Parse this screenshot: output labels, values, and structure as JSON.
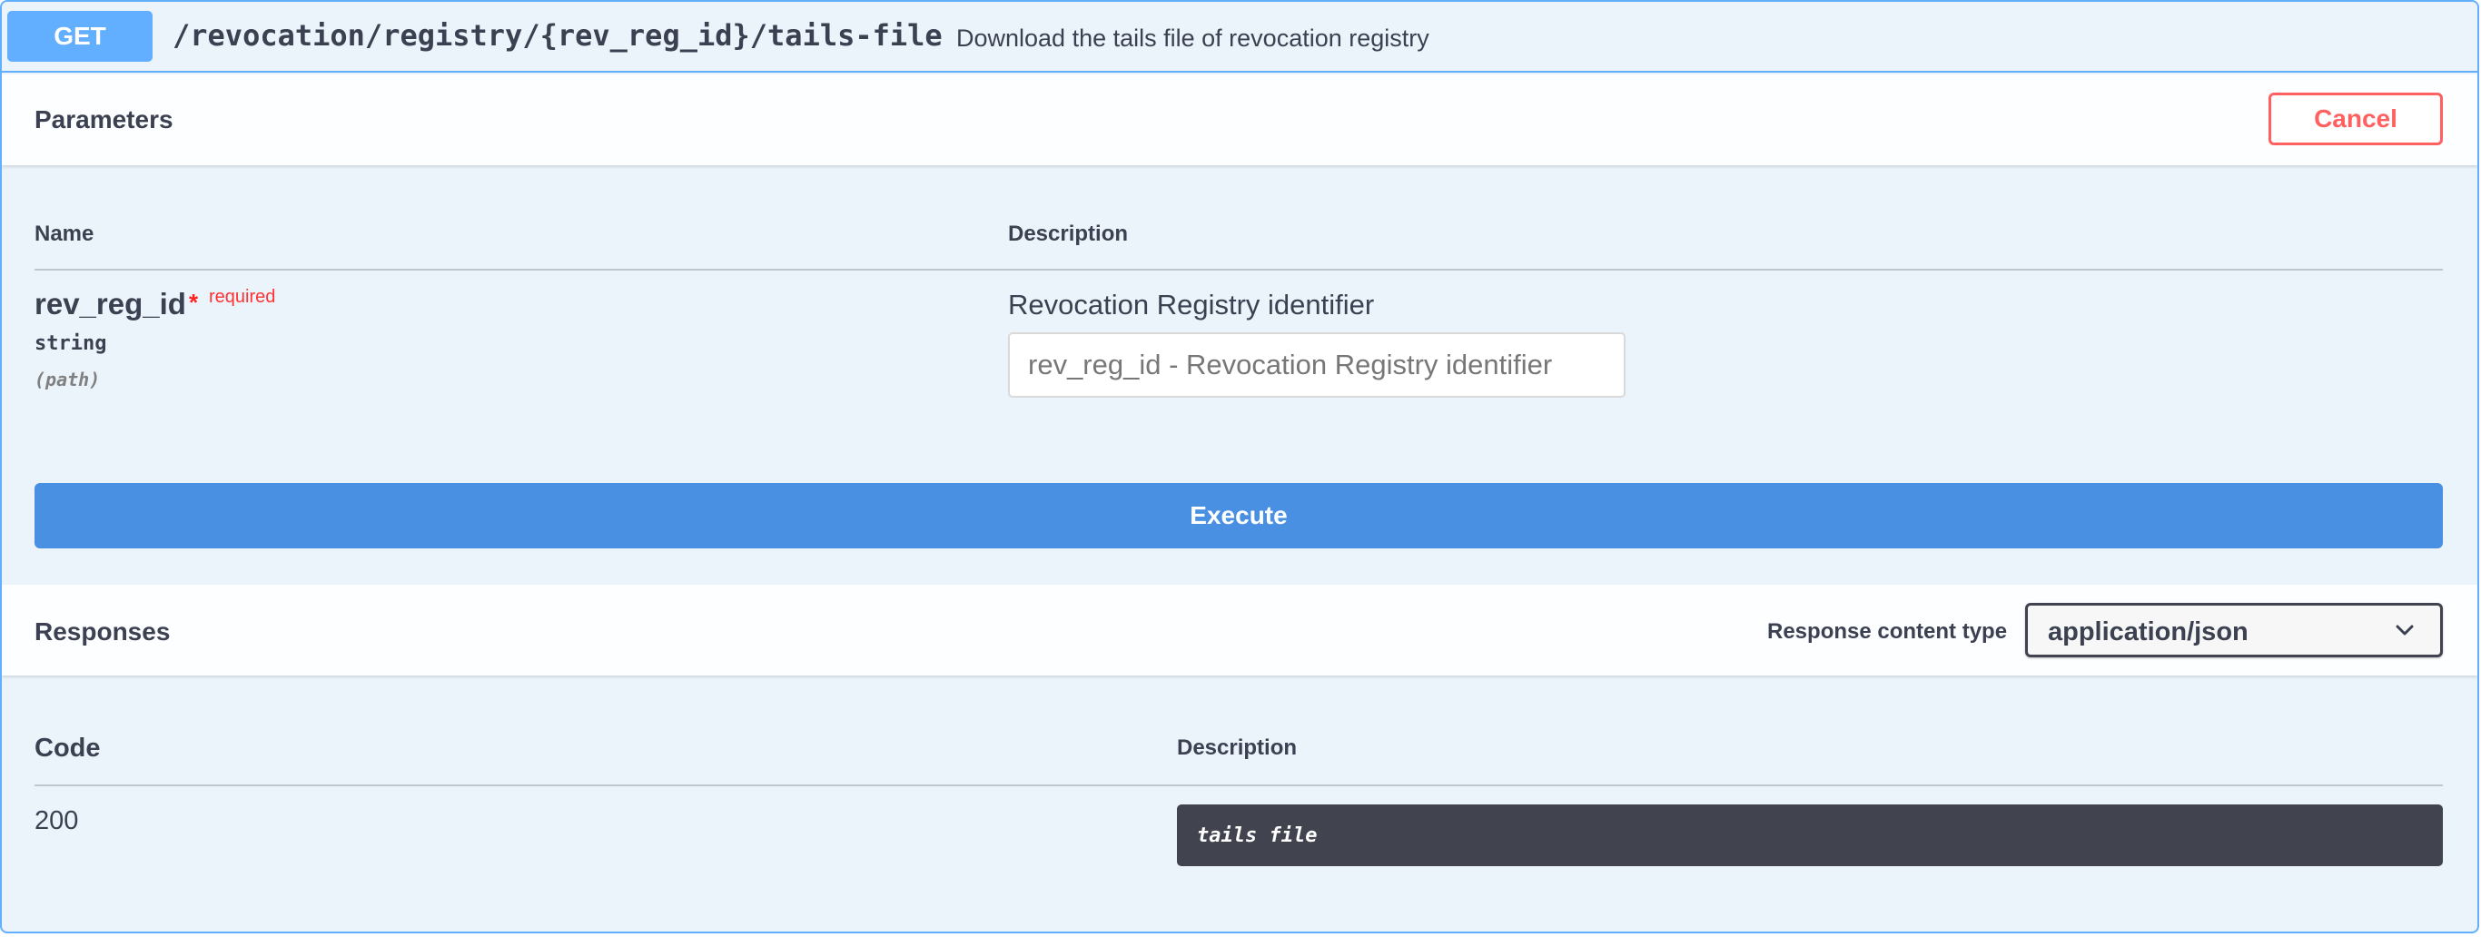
{
  "operation": {
    "method": "GET",
    "path": "/revocation/registry/{rev_reg_id}/tails-file",
    "summary": "Download the tails file of revocation registry"
  },
  "parameters": {
    "title": "Parameters",
    "cancel_label": "Cancel",
    "columns": {
      "name": "Name",
      "description": "Description"
    },
    "items": [
      {
        "name": "rev_reg_id",
        "required_star": "*",
        "required_label": "required",
        "type": "string",
        "in": "(path)",
        "description": "Revocation Registry identifier",
        "placeholder": "rev_reg_id - Revocation Registry identifier",
        "value": ""
      }
    ],
    "execute_label": "Execute"
  },
  "responses": {
    "title": "Responses",
    "content_type_label": "Response content type",
    "content_type_value": "application/json",
    "columns": {
      "code": "Code",
      "description": "Description"
    },
    "items": [
      {
        "code": "200",
        "description": "tails file"
      }
    ]
  },
  "colors": {
    "get_accent": "#61affe",
    "execute": "#4990e2",
    "cancel": "#ff6060",
    "required": "#ff3333",
    "description_box": "#41444e"
  }
}
